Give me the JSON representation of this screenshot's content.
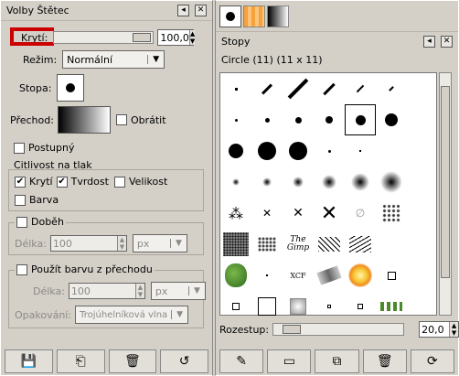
{
  "left": {
    "title": "Volby Štětec",
    "opacity_label": "Krytí:",
    "opacity_value": "100,0",
    "mode_label": "Režim:",
    "mode_value": "Normální",
    "brush_label": "Stopa:",
    "gradient_label": "Přechod:",
    "reverse_label": "Obrátit",
    "incremental_label": "Postupný",
    "pressure_group": "Citlivost na tlak",
    "pressure_opacity": "Krytí",
    "pressure_hardness": "Tvrdost",
    "pressure_size": "Velikost",
    "pressure_color": "Barva",
    "fade_label": "Doběh",
    "fade_length_label": "Délka:",
    "fade_length_value": "100",
    "fade_unit": "px",
    "use_gradient_label": "Použít barvu z přechodu",
    "grad_length_label": "Délka:",
    "grad_length_value": "100",
    "grad_unit": "px",
    "repeat_label": "Opakování:",
    "repeat_value": "Trojúhelníková vlna"
  },
  "right": {
    "title": "Stopy",
    "brush_name": "Circle (11) (11 x 11)",
    "spacing_label": "Rozestup:",
    "spacing_value": "20,0",
    "brush_texts": {
      "gimp": "The Gimp",
      "xcf": "XCF"
    }
  },
  "colors": {
    "accent_red": "#cc0000",
    "grid_bg": "#ffffff"
  }
}
